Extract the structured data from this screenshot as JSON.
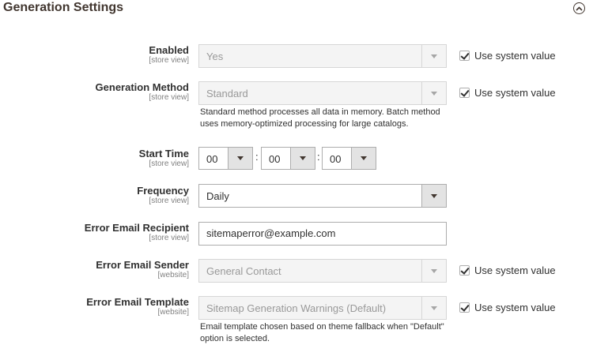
{
  "section": {
    "title": "Generation Settings"
  },
  "fields": {
    "enabled": {
      "label": "Enabled",
      "scope": "[store view]",
      "value": "Yes",
      "use_system_value": "Use system value"
    },
    "generation_method": {
      "label": "Generation Method",
      "scope": "[store view]",
      "value": "Standard",
      "note_line1": "Standard method processes all data in memory. Batch method",
      "note_line2": "uses memory-optimized processing for large catalogs.",
      "use_system_value": "Use system value"
    },
    "start_time": {
      "label": "Start Time",
      "scope": "[store view]",
      "hour": "00",
      "minute": "00",
      "second": "00",
      "separator": ":"
    },
    "frequency": {
      "label": "Frequency",
      "scope": "[store view]",
      "value": "Daily"
    },
    "error_email_recipient": {
      "label": "Error Email Recipient",
      "scope": "[store view]",
      "value": "sitemaperror@example.com"
    },
    "error_email_sender": {
      "label": "Error Email Sender",
      "scope": "[website]",
      "value": "General Contact",
      "use_system_value": "Use system value"
    },
    "error_email_template": {
      "label": "Error Email Template",
      "scope": "[website]",
      "value": "Sitemap Generation Warnings (Default)",
      "note_line1": "Email template chosen based on theme fallback when \"Default\"",
      "note_line2": "option is selected.",
      "use_system_value": "Use system value"
    }
  }
}
